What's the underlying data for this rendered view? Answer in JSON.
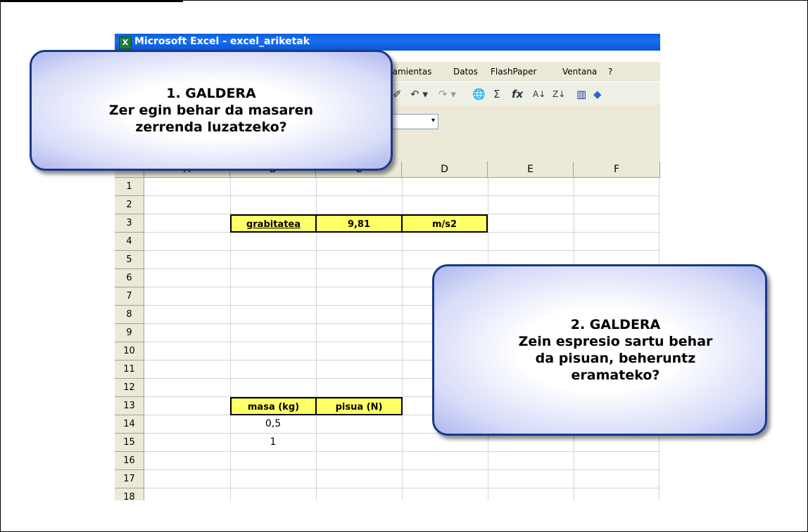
{
  "window": {
    "title": "Microsoft Excel - excel_ariketak"
  },
  "menu": {
    "items_visible": [
      "rramientas",
      "Datos",
      "FlashPaper",
      "Ventana",
      "?"
    ]
  },
  "toolbar": {
    "icons": [
      "format-painter-icon",
      "undo-icon",
      "redo-icon",
      "web-icon",
      "autosum-icon",
      "function-icon",
      "sort-ascending-icon",
      "sort-descending-icon",
      "chart-wizard-icon",
      "drawing-icon"
    ],
    "glyphs": [
      "✐",
      "↶ ▾",
      "↷ ▾",
      "🌐",
      "Σ",
      "fx",
      "A↓",
      "Z↓",
      "▥",
      "◆"
    ]
  },
  "namebox": {
    "arrow": "▾"
  },
  "columns": [
    "A",
    "B",
    "C",
    "D",
    "E",
    "F"
  ],
  "rows": [
    "1",
    "2",
    "3",
    "4",
    "5",
    "6",
    "7",
    "8",
    "9",
    "10",
    "11",
    "12",
    "13",
    "14",
    "15",
    "16",
    "17",
    "18"
  ],
  "cells": {
    "b3": "grabitatea",
    "c3": "9,81",
    "d3": "m/s2",
    "b13": "masa (kg)",
    "c13": "pisua (N)",
    "b14": "0,5",
    "b15": "1"
  },
  "callout1": {
    "text": "1. GALDERA\nZer egin behar da masaren\nzerrenda luzatzeko?"
  },
  "callout2": {
    "text": "2. GALDERA\nZein espresio sartu behar\nda pisuan, beheruntz\neramateko?"
  },
  "colors": {
    "titlebar": "#0a5fe0",
    "highlight": "#ffff66",
    "callout_border": "#17398a"
  }
}
